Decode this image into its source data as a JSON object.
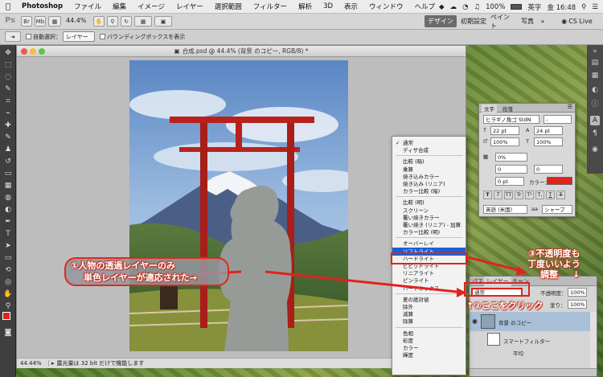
{
  "menubar": {
    "items": [
      "Photoshop",
      "ファイル",
      "編集",
      "イメージ",
      "レイヤー",
      "選択範囲",
      "フィルター",
      "解析",
      "3D",
      "表示",
      "ウィンドウ",
      "ヘルプ"
    ],
    "status": {
      "battery": "100%",
      "ime": "英字",
      "clock": "金 16:48"
    }
  },
  "appbar": {
    "logo": "Ps",
    "zoom": "44.4%",
    "workspaces": [
      "デザイン",
      "初期設定",
      "ペイント",
      "写真"
    ],
    "more": "»",
    "cslive": "CS Live"
  },
  "optbar": {
    "auto_select": "自動選択：",
    "auto_select_value": "レイヤー",
    "bbox": "バウンディングボックスを表示"
  },
  "document": {
    "title": "合成.psd @ 44.4% (背景 のコピー, RGB/8) *",
    "status_zoom": "44.44%",
    "status_text": "露光量は 32 bit だけで機能します"
  },
  "blend_menu": {
    "items": [
      {
        "label": "通常",
        "checked": true
      },
      {
        "label": "ディザ合成"
      },
      {
        "sep": true
      },
      {
        "label": "比較 (暗)"
      },
      {
        "label": "乗算"
      },
      {
        "label": "焼き込みカラー"
      },
      {
        "label": "焼き込み (リニア)"
      },
      {
        "label": "カラー比較 (暗)"
      },
      {
        "sep": true
      },
      {
        "label": "比較 (明)"
      },
      {
        "label": "スクリーン"
      },
      {
        "label": "覆い焼きカラー"
      },
      {
        "label": "覆い焼き (リニア) - 加算"
      },
      {
        "label": "カラー比較 (明)"
      },
      {
        "sep": true
      },
      {
        "label": "オーバーレイ"
      },
      {
        "label": "ソフトライト",
        "selected": true
      },
      {
        "label": "ハードライト"
      },
      {
        "label": "ビビッドライト"
      },
      {
        "label": "リニアライト"
      },
      {
        "label": "ピンライト"
      },
      {
        "label": "ハードミックス"
      },
      {
        "sep": true
      },
      {
        "label": "差の絶対値"
      },
      {
        "label": "除外"
      },
      {
        "label": "減算"
      },
      {
        "label": "除算"
      },
      {
        "sep": true
      },
      {
        "label": "色相"
      },
      {
        "label": "彩度"
      },
      {
        "label": "カラー"
      },
      {
        "label": "輝度"
      }
    ]
  },
  "char_panel": {
    "tabs": [
      "文字",
      "段落"
    ],
    "font": "ヒラギノ角ゴ StdN",
    "style": "-",
    "size": "22 pt",
    "leading": "24 pt",
    "tracking_a": "0",
    "tracking_b": "0",
    "vscale": "100%",
    "hscale": "100%",
    "tsume": "0%",
    "baseline": "0 pt",
    "color_label": "カラー：",
    "lang": "英語 (米国)",
    "aa": "シャープ",
    "faux": [
      "T",
      "T",
      "TT",
      "Tr",
      "T¹",
      "T,",
      "T",
      "T"
    ],
    "accent_color": "#e0231b"
  },
  "layers_panel": {
    "tabs": [
      "パス",
      "レイヤー",
      "チャン"
    ],
    "blend": "通常",
    "opacity_label": "不透明度：",
    "opacity": "100%",
    "fill_label": "塗り：",
    "fill": "100%",
    "layers": [
      "背景 のコピー",
      "スマートフィルター",
      "平均"
    ]
  },
  "annotations": {
    "a1_line1": "①人物の透過レイヤーのみ",
    "a1_line2": "単色レイヤーが適応された→",
    "a2": "↑②ここをクリック",
    "a3_line1": "③不透明度も",
    "a3_line2": "丁度いいよう",
    "a3_line3": "調整",
    "a3_arrow": "↓",
    "color": "#e0231b"
  }
}
